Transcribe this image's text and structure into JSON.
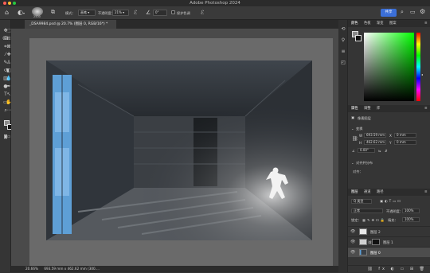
{
  "app": {
    "title": "Adobe Photoshop 2024"
  },
  "options": {
    "brush_size": "2500",
    "mode_label": "模式：",
    "mode_value": "画笔",
    "opacity_label": "不透明度：",
    "opacity_value": "21%",
    "angle_value": "0°",
    "smoothing_label": "保护色调",
    "share": "共享"
  },
  "document": {
    "tab": "_DSA9984.psd @ 20.7% (图层 0, RGB/16*) *"
  },
  "status": {
    "zoom": "20.66%",
    "info": "693.59 mm x 462.62 mm (300...."
  },
  "color_panel": {
    "tabs": [
      "颜色",
      "色板",
      "渐变",
      "图案"
    ]
  },
  "properties_panel": {
    "tabs": [
      "属性",
      "调整",
      "库"
    ],
    "layer_type": "像素图层",
    "transform_label": "变换",
    "w_label": "W",
    "w_value": "693.59 mm",
    "h_label": "H",
    "h_value": "462.62 mm",
    "x_label": "X",
    "x_value": "0 mm",
    "y_label": "Y",
    "y_value": "0 mm",
    "angle": "0.00°",
    "align_label": "对齐并分布",
    "align_sub": "对齐："
  },
  "layers_panel": {
    "tabs": [
      "图层",
      "通道",
      "路径"
    ],
    "filter": "Q 类型",
    "blend": "正常",
    "opacity_label": "不透明度：",
    "opacity": "100%",
    "lock_label": "锁定：",
    "fill_label": "填充：",
    "fill": "100%",
    "layers": [
      {
        "name": "图层 2"
      },
      {
        "name": "图层 1"
      },
      {
        "name": "图层 0"
      }
    ]
  },
  "colors": {
    "accent": "#3b6fd8",
    "panel_bg": "#353535",
    "canvas_bg": "#4a4a4a"
  }
}
